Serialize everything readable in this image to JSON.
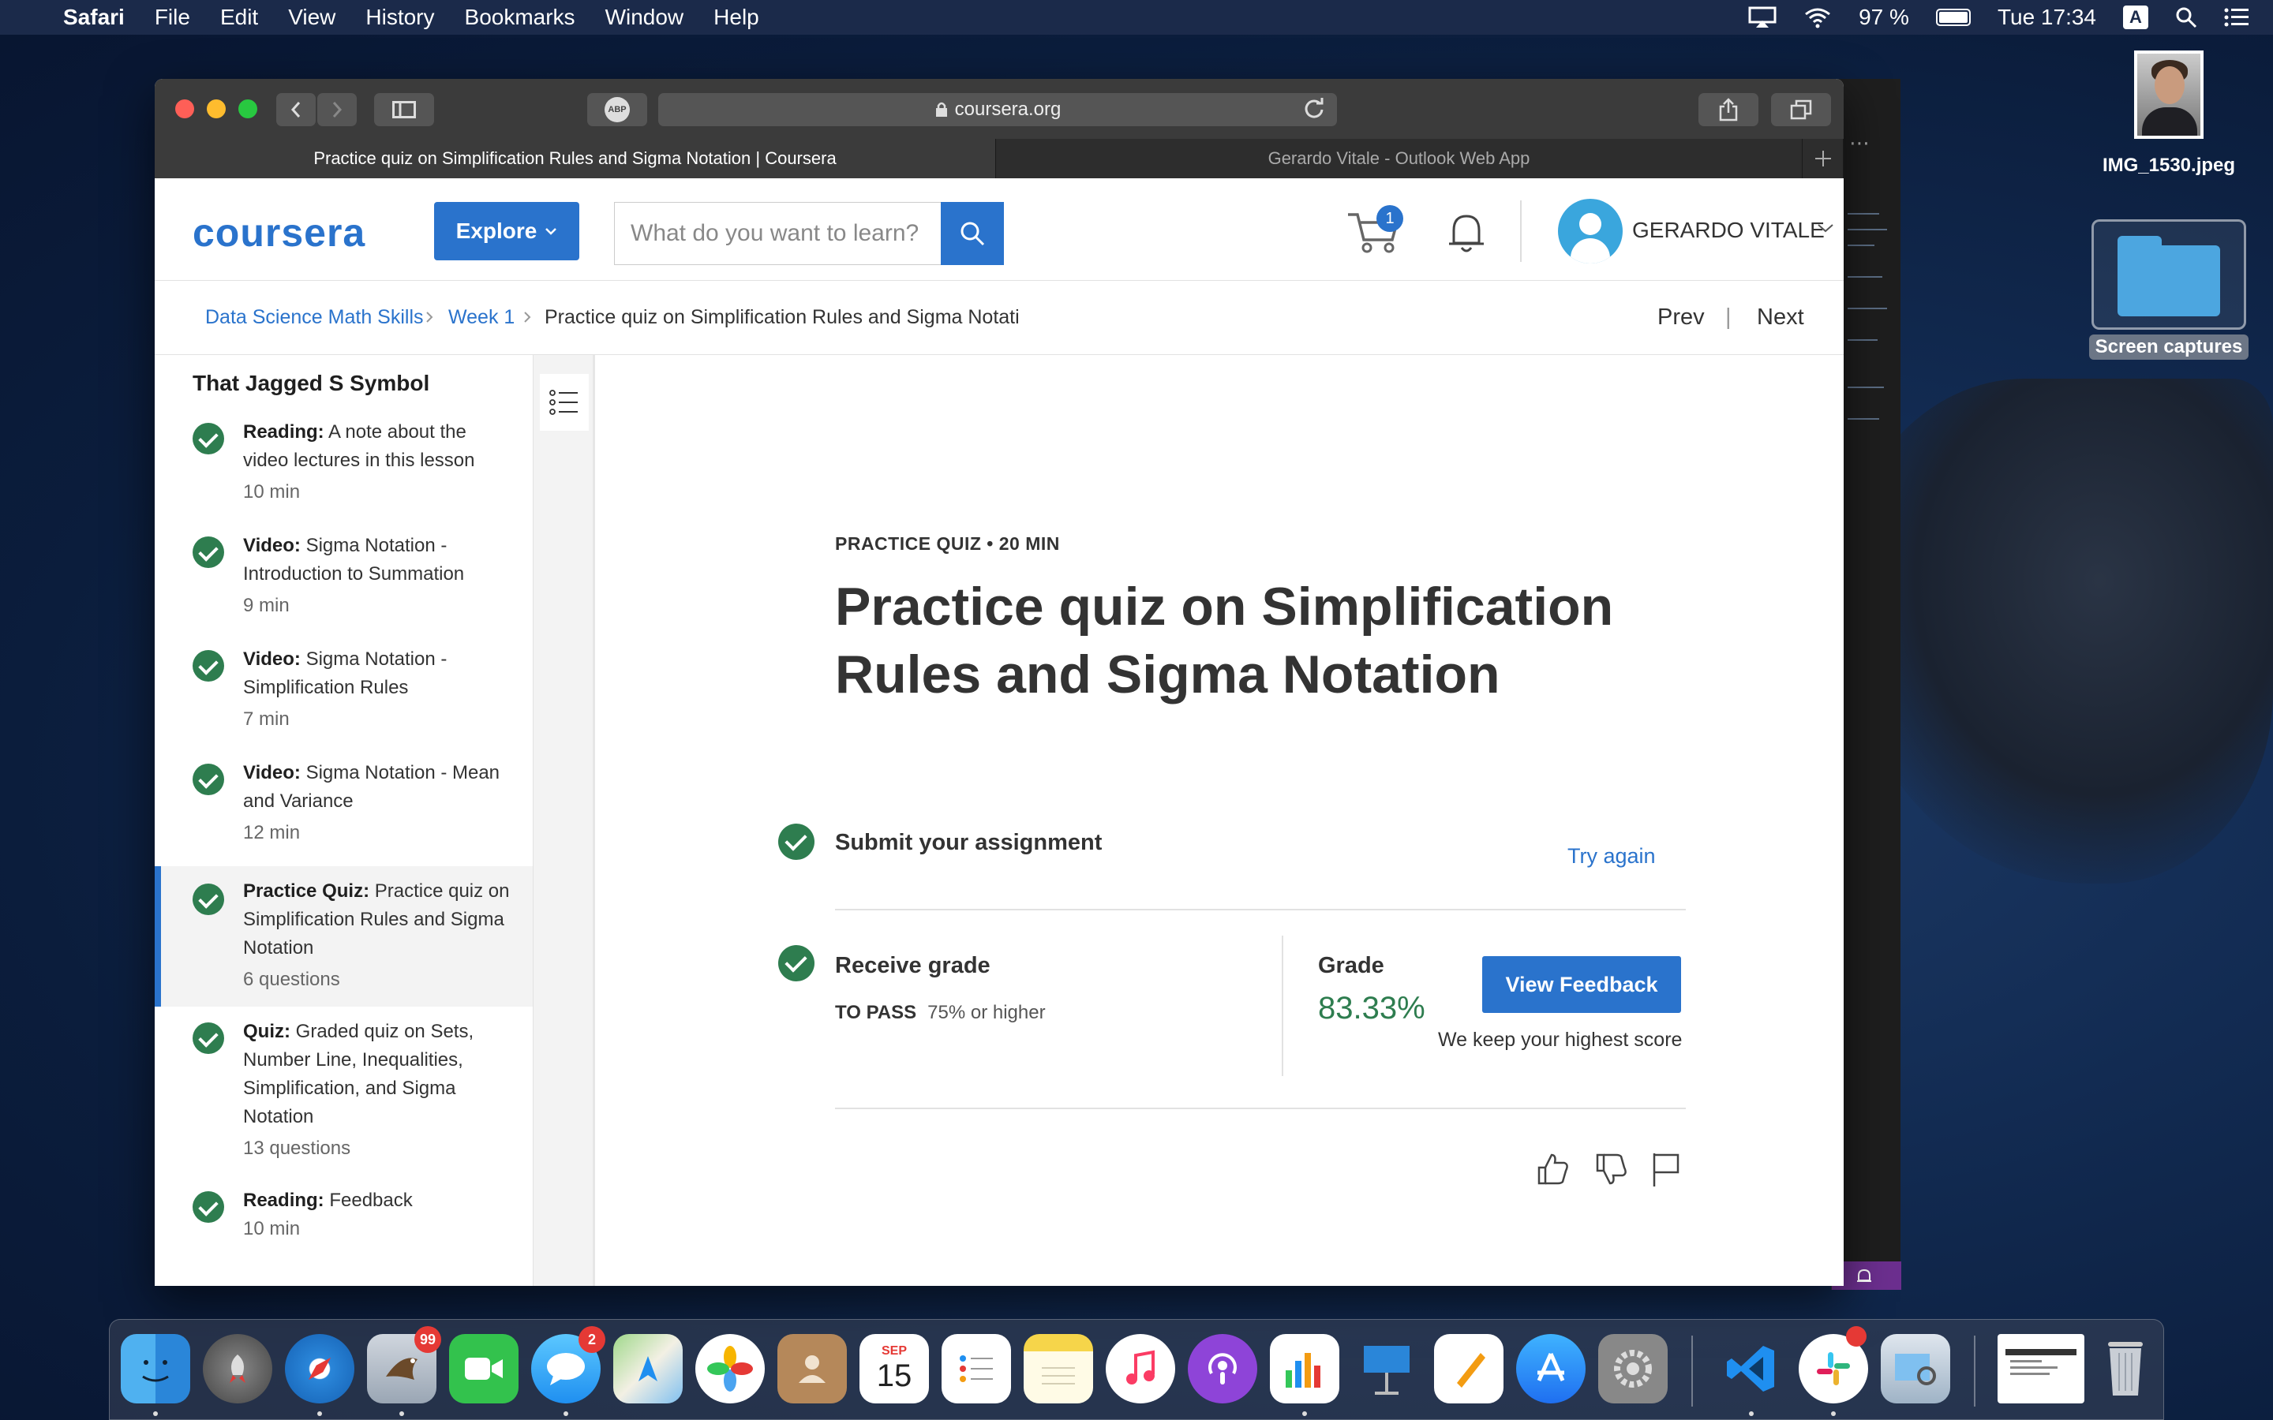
{
  "menubar": {
    "app": "Safari",
    "items": [
      "File",
      "Edit",
      "View",
      "History",
      "Bookmarks",
      "Window",
      "Help"
    ],
    "battery": "97 %",
    "clock": "Tue 17:34",
    "input_source": "A"
  },
  "desktop": {
    "photo_label": "IMG_1530.jpeg",
    "folder_label": "Screen captures"
  },
  "browser": {
    "url": "coursera.org",
    "abp_label": "ABP",
    "tabs": [
      "Practice quiz on Simplification Rules and Sigma Notation | Coursera",
      "Gerardo Vitale - Outlook Web App"
    ]
  },
  "header": {
    "logo": "coursera",
    "explore": "Explore",
    "search_placeholder": "What do you want to learn?",
    "cart_count": "1",
    "user_name": "GERARDO VITALE"
  },
  "breadcrumb": {
    "items": [
      "Data Science Math Skills",
      "Week 1",
      "Practice quiz on Simplification Rules and Sigma Notati"
    ],
    "prev": "Prev",
    "separator": "|",
    "next": "Next"
  },
  "sidebar": {
    "title": "That Jagged S Symbol",
    "items": [
      {
        "type": "Reading:",
        "title": "A note about the video lectures in this lesson",
        "meta": "10 min"
      },
      {
        "type": "Video:",
        "title": "Sigma Notation - Introduction to Summation",
        "meta": "9 min"
      },
      {
        "type": "Video:",
        "title": "Sigma Notation - Simplification Rules",
        "meta": "7 min"
      },
      {
        "type": "Video:",
        "title": "Sigma Notation - Mean and Variance",
        "meta": "12 min"
      },
      {
        "type": "Practice Quiz:",
        "title": "Practice quiz on Simplification Rules and Sigma Notation",
        "meta": "6 questions"
      },
      {
        "type": "Quiz:",
        "title": "Graded quiz on Sets, Number Line, Inequalities, Simplification, and Sigma Notation",
        "meta": "13 questions"
      },
      {
        "type": "Reading:",
        "title": "Feedback",
        "meta": "10 min"
      }
    ]
  },
  "main": {
    "kicker": "PRACTICE QUIZ • 20 MIN",
    "title": "Practice quiz on Simplification Rules and Sigma Notation",
    "submit_title": "Submit your assignment",
    "try_again": "Try again",
    "receive_title": "Receive grade",
    "to_pass_label": "TO PASS",
    "to_pass_value": "75% or higher",
    "grade_label": "Grade",
    "grade_value": "83.33%",
    "view_feedback": "View Feedback",
    "keep_note": "We keep your highest score"
  },
  "dock": {
    "mail_badge": "99",
    "messages_badge": "2",
    "calendar_month": "SEP",
    "calendar_day": "15"
  },
  "colors": {
    "accent": "#2a73cc",
    "success": "#2e7d4f"
  }
}
